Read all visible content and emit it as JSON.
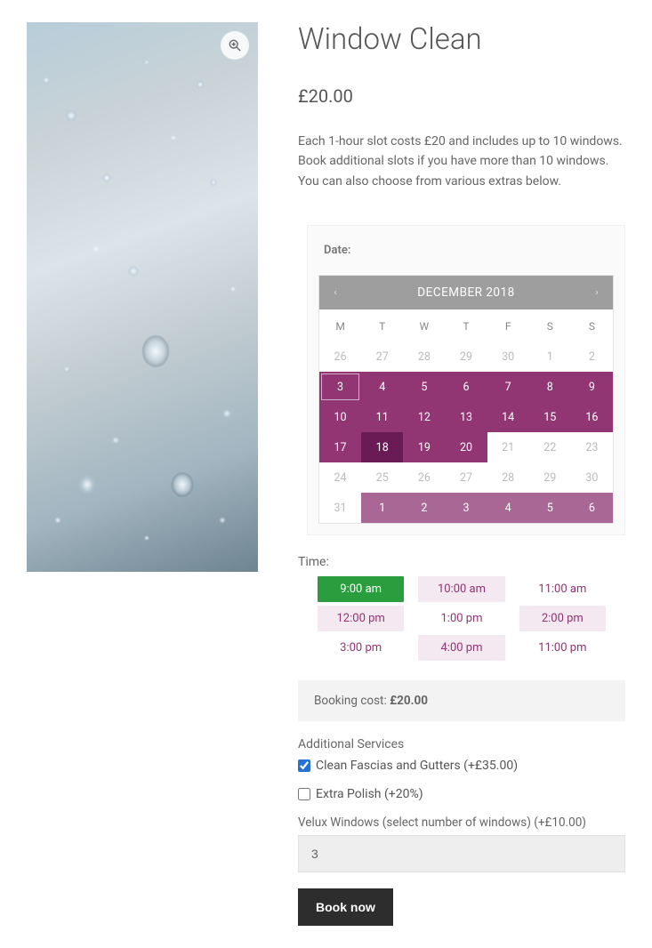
{
  "product": {
    "title": "Window Clean",
    "price": "£20.00",
    "description": "Each 1-hour slot costs £20 and includes up to 10 windows. Book additional slots if you have more than 10 windows. You can also choose from various extras below."
  },
  "date_picker": {
    "label": "Date:",
    "month_title": "DECEMBER 2018",
    "dow": [
      "M",
      "T",
      "W",
      "T",
      "F",
      "S",
      "S"
    ],
    "weeks": [
      [
        {
          "n": "26",
          "s": "prev"
        },
        {
          "n": "27",
          "s": "prev"
        },
        {
          "n": "28",
          "s": "prev"
        },
        {
          "n": "29",
          "s": "prev"
        },
        {
          "n": "30",
          "s": "prev"
        },
        {
          "n": "1",
          "s": "off"
        },
        {
          "n": "2",
          "s": "off"
        }
      ],
      [
        {
          "n": "3",
          "s": "bookable",
          "today": true
        },
        {
          "n": "4",
          "s": "bookable"
        },
        {
          "n": "5",
          "s": "bookable"
        },
        {
          "n": "6",
          "s": "bookable"
        },
        {
          "n": "7",
          "s": "bookable"
        },
        {
          "n": "8",
          "s": "bookable"
        },
        {
          "n": "9",
          "s": "bookable"
        }
      ],
      [
        {
          "n": "10",
          "s": "bookable"
        },
        {
          "n": "11",
          "s": "bookable"
        },
        {
          "n": "12",
          "s": "bookable"
        },
        {
          "n": "13",
          "s": "bookable"
        },
        {
          "n": "14",
          "s": "bookable"
        },
        {
          "n": "15",
          "s": "bookable"
        },
        {
          "n": "16",
          "s": "bookable"
        }
      ],
      [
        {
          "n": "17",
          "s": "bookable"
        },
        {
          "n": "18",
          "s": "bookable",
          "selected": true
        },
        {
          "n": "19",
          "s": "bookable"
        },
        {
          "n": "20",
          "s": "bookable"
        },
        {
          "n": "21",
          "s": "off"
        },
        {
          "n": "22",
          "s": "off"
        },
        {
          "n": "23",
          "s": "off"
        }
      ],
      [
        {
          "n": "24",
          "s": "off"
        },
        {
          "n": "25",
          "s": "off"
        },
        {
          "n": "26",
          "s": "off"
        },
        {
          "n": "27",
          "s": "off"
        },
        {
          "n": "28",
          "s": "off"
        },
        {
          "n": "29",
          "s": "off"
        },
        {
          "n": "30",
          "s": "off"
        }
      ],
      [
        {
          "n": "31",
          "s": "off"
        },
        {
          "n": "1",
          "s": "next"
        },
        {
          "n": "2",
          "s": "next"
        },
        {
          "n": "3",
          "s": "next"
        },
        {
          "n": "4",
          "s": "next"
        },
        {
          "n": "5",
          "s": "next"
        },
        {
          "n": "6",
          "s": "next"
        }
      ]
    ]
  },
  "time": {
    "label": "Time:",
    "slots": [
      {
        "t": "9:00 am",
        "style": "selected"
      },
      {
        "t": "10:00 am",
        "style": "shaded"
      },
      {
        "t": "11:00 am",
        "style": "plain"
      },
      {
        "t": "12:00 pm",
        "style": "shaded"
      },
      {
        "t": "1:00 pm",
        "style": "plain"
      },
      {
        "t": "2:00 pm",
        "style": "shaded"
      },
      {
        "t": "3:00 pm",
        "style": "plain"
      },
      {
        "t": "4:00 pm",
        "style": "shaded"
      },
      {
        "t": "11:00 pm",
        "style": "plain"
      }
    ]
  },
  "cost": {
    "label": "Booking cost: ",
    "value": "£20.00"
  },
  "addons": {
    "title": "Additional Services",
    "items": [
      {
        "label": "Clean Fascias and Gutters (+£35.00)",
        "checked": true
      },
      {
        "label": "Extra Polish (+20%)",
        "checked": false
      }
    ]
  },
  "velux": {
    "label": "Velux Windows (select number of windows) (+£10.00)",
    "value": "3"
  },
  "buttons": {
    "book": "Book now"
  }
}
